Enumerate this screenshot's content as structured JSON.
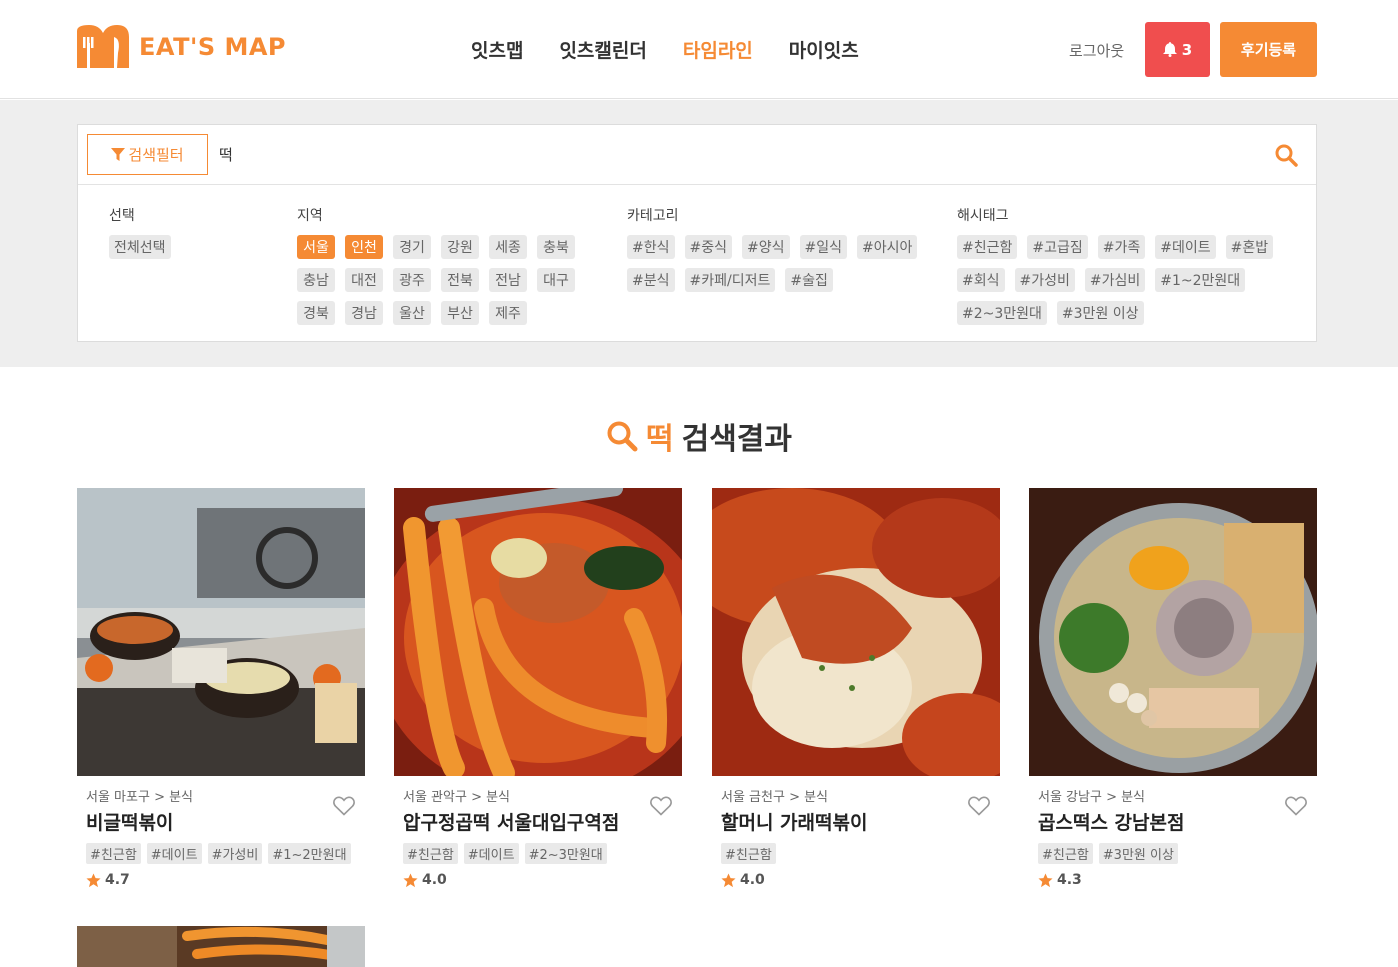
{
  "header": {
    "logo_text": "EAT'S MAP",
    "nav": [
      "잇츠맵",
      "잇츠캘린더",
      "타임라인",
      "마이잇츠"
    ],
    "active_nav": 2,
    "logout": "로그아웃",
    "notif_count": "3",
    "review_button": "후기등록",
    "accent": "#f58a34",
    "notif_color": "#f04e4e"
  },
  "search": {
    "filter_button": "검색필터",
    "query": "떡"
  },
  "filters": {
    "select": {
      "title": "선택",
      "chips": [
        "전체선택"
      ]
    },
    "region": {
      "title": "지역",
      "chips": [
        "서울",
        "인천",
        "경기",
        "강원",
        "세종",
        "충북",
        "충남",
        "대전",
        "광주",
        "전북",
        "전남",
        "대구",
        "경북",
        "경남",
        "울산",
        "부산",
        "제주"
      ],
      "selected": [
        "서울",
        "인천"
      ]
    },
    "category": {
      "title": "카테고리",
      "chips": [
        "#한식",
        "#중식",
        "#양식",
        "#일식",
        "#아시아",
        "#분식",
        "#카페/디저트",
        "#술집"
      ]
    },
    "hashtag": {
      "title": "해시태그",
      "chips": [
        "#친근함",
        "#고급짐",
        "#가족",
        "#데이트",
        "#혼밥",
        "#회식",
        "#가성비",
        "#가심비",
        "#1~2만원대",
        "#2~3만원대",
        "#3만원 이상"
      ]
    }
  },
  "results": {
    "keyword": "떡",
    "title_suffix": "검색결과",
    "items": [
      {
        "location": "서울 마포구 > 분식",
        "name": "비글떡볶이",
        "tags": [
          "#친근함",
          "#데이트",
          "#가성비",
          "#1~2만원대"
        ],
        "rating": "4.7"
      },
      {
        "location": "서울 관악구 > 분식",
        "name": "압구정곱떡 서울대입구역점",
        "tags": [
          "#친근함",
          "#데이트",
          "#2~3만원대"
        ],
        "rating": "4.0"
      },
      {
        "location": "서울 금천구 > 분식",
        "name": "할머니 가래떡볶이",
        "tags": [
          "#친근함"
        ],
        "rating": "4.0"
      },
      {
        "location": "서울 강남구 > 분식",
        "name": "곱스떡스 강남본점",
        "tags": [
          "#친근함",
          "#3만원 이상"
        ],
        "rating": "4.3"
      }
    ]
  }
}
